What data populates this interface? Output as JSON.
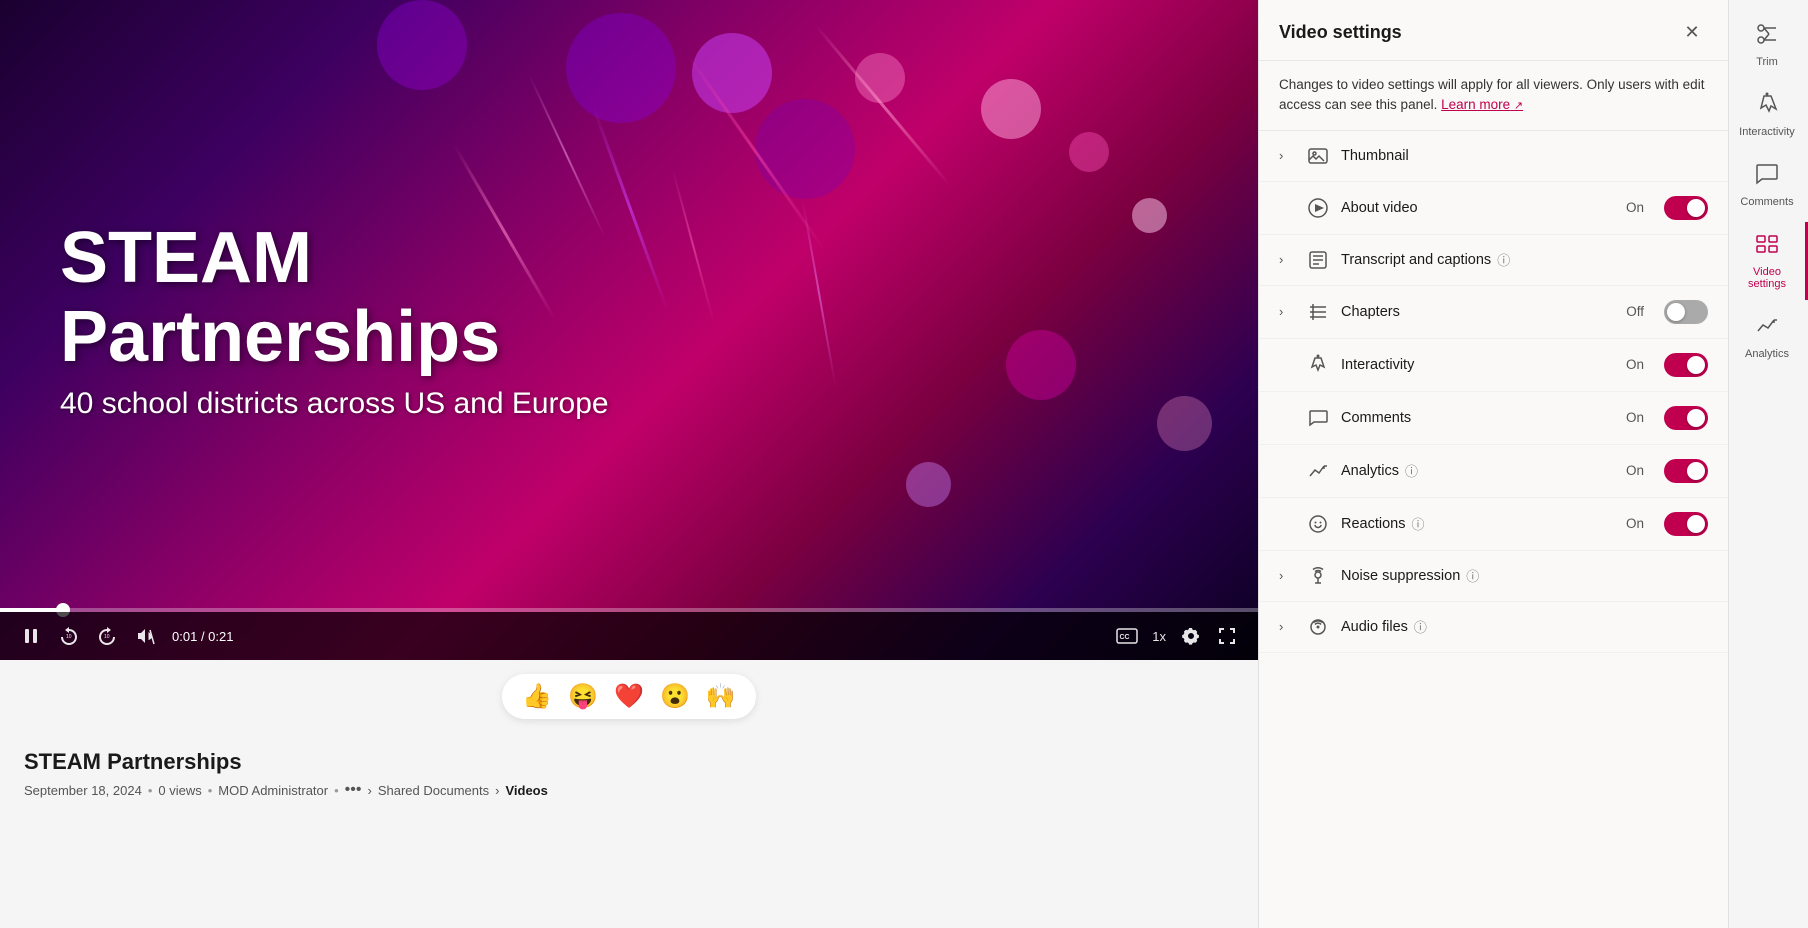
{
  "video": {
    "title_line1": "STEAM",
    "title_line2": "Partnerships",
    "subtitle": "40 school districts across US and Europe",
    "time_current": "0:01",
    "time_total": "0:21",
    "progress_percent": 5
  },
  "info": {
    "title": "STEAM Partnerships",
    "date": "September 18, 2024",
    "views": "0 views",
    "author": "MOD Administrator",
    "path1": "Shared Documents",
    "path2": "Videos",
    "dots": "•••"
  },
  "reactions": {
    "emojis": [
      "👍",
      "😝",
      "❤️",
      "😮",
      "🙌"
    ]
  },
  "settings": {
    "title": "Video settings",
    "description": "Changes to video settings will apply for all viewers. Only users with edit access can see this panel.",
    "learn_more": "Learn more",
    "rows": [
      {
        "id": "thumbnail",
        "label": "Thumbnail",
        "expandable": true,
        "has_toggle": false,
        "icon": "image"
      },
      {
        "id": "about-video",
        "label": "About video",
        "expandable": false,
        "has_toggle": true,
        "status": "On",
        "toggle_on": true,
        "icon": "play"
      },
      {
        "id": "transcript",
        "label": "Transcript and captions",
        "expandable": true,
        "has_toggle": false,
        "icon": "transcript",
        "info": true
      },
      {
        "id": "chapters",
        "label": "Chapters",
        "expandable": true,
        "has_toggle": true,
        "status": "Off",
        "toggle_on": false,
        "icon": "chapters"
      },
      {
        "id": "interactivity",
        "label": "Interactivity",
        "expandable": false,
        "has_toggle": true,
        "status": "On",
        "toggle_on": true,
        "icon": "interactivity"
      },
      {
        "id": "comments",
        "label": "Comments",
        "expandable": false,
        "has_toggle": true,
        "status": "On",
        "toggle_on": true,
        "icon": "comments"
      },
      {
        "id": "analytics",
        "label": "Analytics",
        "expandable": false,
        "has_toggle": true,
        "status": "On",
        "toggle_on": true,
        "icon": "analytics",
        "info": true
      },
      {
        "id": "reactions",
        "label": "Reactions",
        "expandable": false,
        "has_toggle": true,
        "status": "On",
        "toggle_on": true,
        "icon": "reactions",
        "info": true
      },
      {
        "id": "noise-suppression",
        "label": "Noise suppression",
        "expandable": true,
        "has_toggle": false,
        "icon": "noise",
        "info": true
      },
      {
        "id": "audio-files",
        "label": "Audio files",
        "expandable": true,
        "has_toggle": false,
        "icon": "audio",
        "info": true
      }
    ]
  },
  "right_nav": {
    "items": [
      {
        "id": "trim",
        "label": "Trim",
        "icon": "trim"
      },
      {
        "id": "interactivity",
        "label": "Interactivity",
        "icon": "interactivity"
      },
      {
        "id": "comments",
        "label": "Comments",
        "icon": "comments"
      },
      {
        "id": "video-settings",
        "label": "Video settings",
        "icon": "settings",
        "active": true
      },
      {
        "id": "analytics",
        "label": "Analytics",
        "icon": "analytics"
      }
    ]
  }
}
